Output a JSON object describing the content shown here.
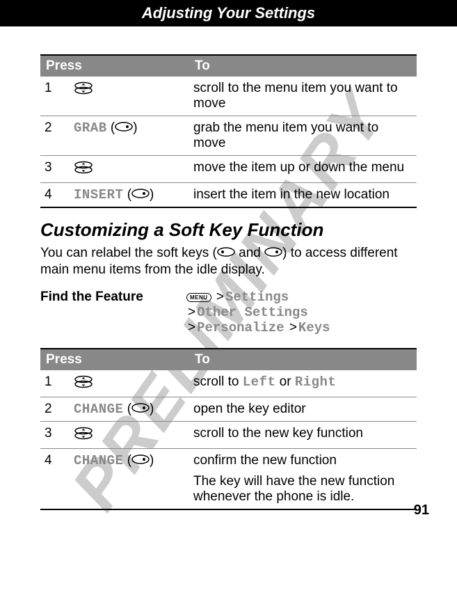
{
  "watermark": "PRELIMINARY",
  "header_title": "Adjusting Your Settings",
  "page_number": "91",
  "table1": {
    "head_press": "Press",
    "head_to": "To",
    "rows": [
      {
        "num": "1",
        "press_label": "",
        "press_icon": "nav",
        "to": "scroll to the menu item you want to move"
      },
      {
        "num": "2",
        "press_label": "GRAB",
        "press_icon": "softkey",
        "to": "grab the menu item you want to move"
      },
      {
        "num": "3",
        "press_label": "",
        "press_icon": "nav",
        "to": "move the item up or down the menu"
      },
      {
        "num": "4",
        "press_label": "INSERT",
        "press_icon": "softkey",
        "to": "insert the item in the new location"
      }
    ]
  },
  "section2_title": "Customizing a Soft Key Function",
  "section2_body_pre": "You can relabel the soft keys (",
  "section2_body_mid": " and ",
  "section2_body_post": ") to access different main menu items from the idle display.",
  "feature": {
    "label": "Find the Feature",
    "menu_key": "MENU",
    "path": [
      [
        "Settings"
      ],
      [
        "Other Settings"
      ],
      [
        "Personalize",
        "Keys"
      ]
    ]
  },
  "table2": {
    "head_press": "Press",
    "head_to": "To",
    "rows": [
      {
        "num": "1",
        "press_label": "",
        "press_icon": "nav",
        "to_pre": "scroll to ",
        "to_m1": "Left",
        "to_mid": " or ",
        "to_m2": "Right",
        "to_post": ""
      },
      {
        "num": "2",
        "press_label": "CHANGE",
        "press_icon": "softkey",
        "to_pre": "open the key editor"
      },
      {
        "num": "3",
        "press_label": "",
        "press_icon": "nav",
        "to_pre": "scroll to the new key function"
      },
      {
        "num": "4",
        "press_label": "CHANGE",
        "press_icon": "softkey",
        "to_pre": "confirm the new function",
        "to_extra": "The key will have the new function whenever the phone is idle."
      }
    ]
  }
}
